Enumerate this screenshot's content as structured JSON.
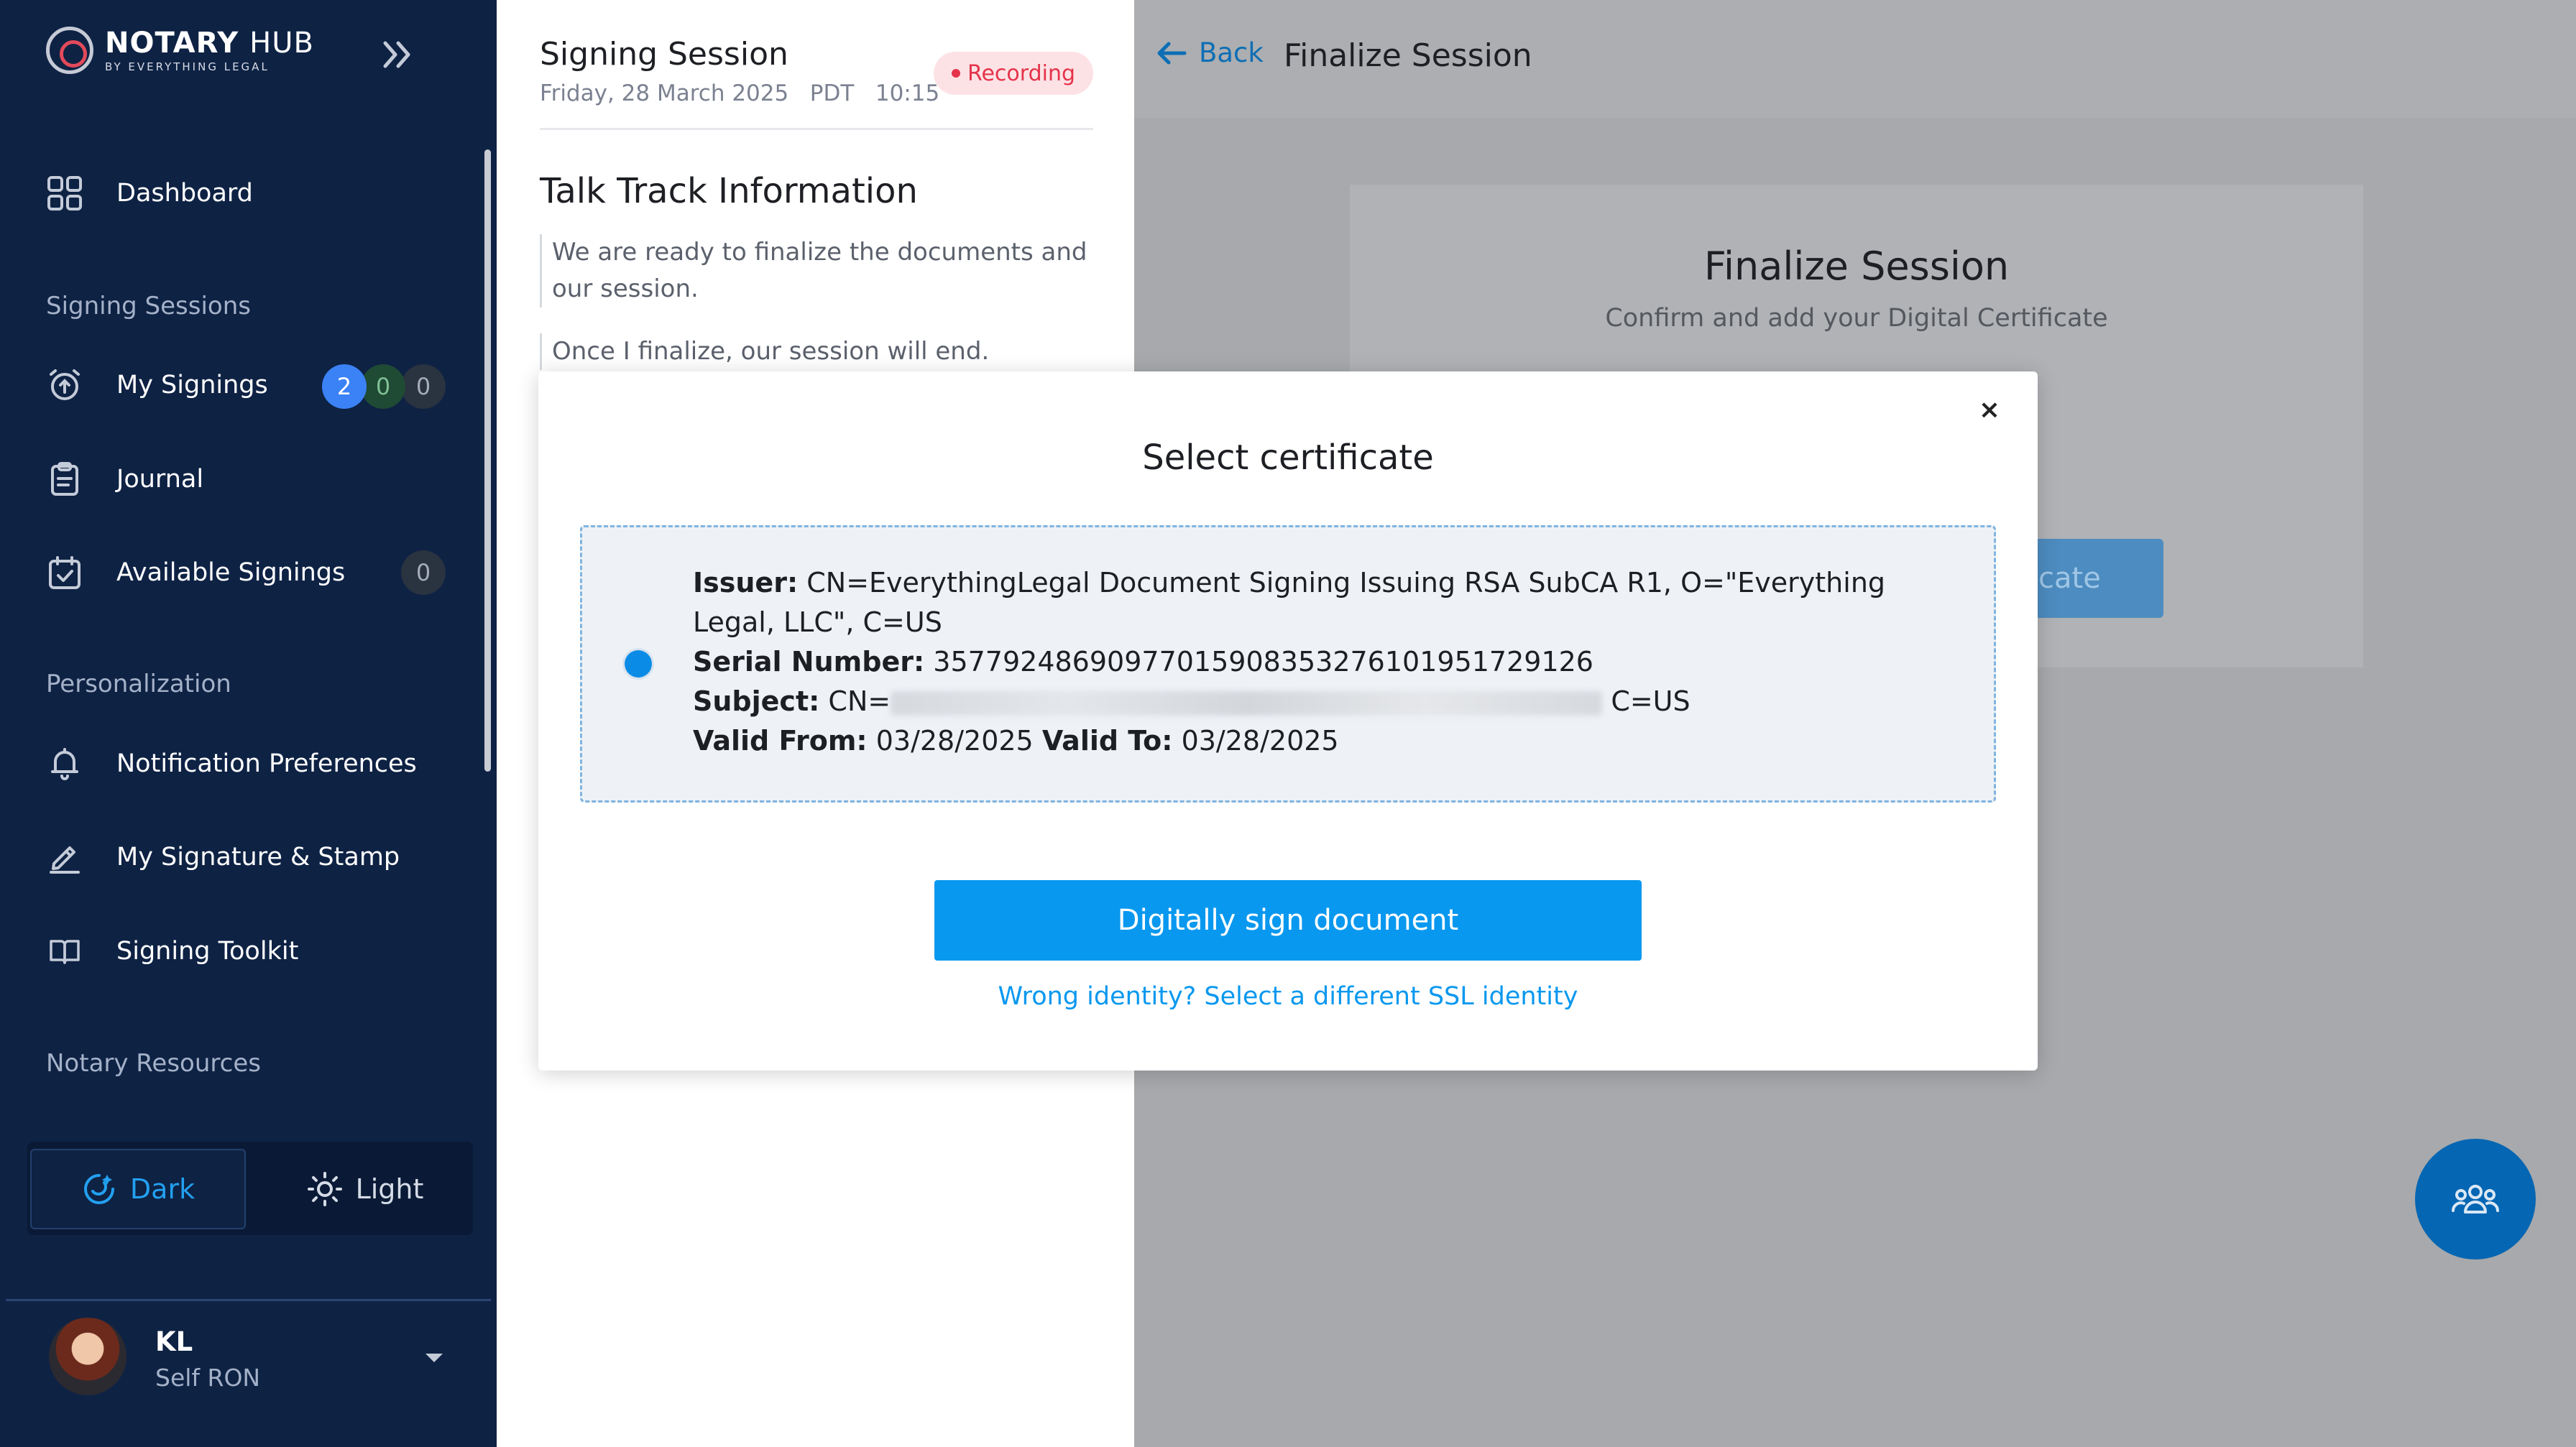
{
  "sidebar": {
    "brand": {
      "title_main": "NOTARY",
      "title_hub": "HUB",
      "subtitle": "BY EVERYTHING LEGAL"
    },
    "nav": {
      "dashboard": "Dashboard",
      "section_signing": "Signing Sessions",
      "my_signings": "My Signings",
      "my_signings_badges": [
        "2",
        "0",
        "0"
      ],
      "journal": "Journal",
      "available_signings": "Available Signings",
      "available_signings_badge": "0",
      "section_personalization": "Personalization",
      "notification_preferences": "Notification Preferences",
      "signature_stamp": "My Signature & Stamp",
      "signing_toolkit": "Signing Toolkit",
      "section_resources": "Notary Resources"
    },
    "theme": {
      "dark": "Dark",
      "light": "Light",
      "selected": "Dark"
    },
    "user": {
      "initials": "KL",
      "role": "Self RON"
    }
  },
  "session": {
    "title": "Signing Session",
    "date": "Friday, 28 March 2025",
    "timezone": "PDT",
    "time": "10:15",
    "status": "Recording",
    "talk_track_title": "Talk Track Information",
    "talk_track": [
      "We are ready to finalize the documents and our session.",
      "Once I finalize, our session will end."
    ]
  },
  "page": {
    "back": "Back",
    "title": "Finalize Session",
    "card_title": "Finalize Session",
    "card_subtitle": "Confirm and add your Digital Certificate",
    "card_button_partial": "cate"
  },
  "modal": {
    "title": "Select certificate",
    "close": "×",
    "certificate": {
      "issuer_label": "Issuer:",
      "issuer": "CN=EverythingLegal Document Signing Issuing RSA SubCA R1, O=\"Everything Legal, LLC\", C=US",
      "serial_label": "Serial Number:",
      "serial": "35779248690977015908353276101951729126",
      "subject_label": "Subject:",
      "subject_prefix": "CN=",
      "subject_suffix": "C=US",
      "valid_from_label": "Valid From:",
      "valid_from": "03/28/2025",
      "valid_to_label": "Valid To:",
      "valid_to": "03/28/2025",
      "selected": true
    },
    "sign_button": "Digitally sign document",
    "wrong_identity": "Wrong identity? Select a different SSL identity"
  },
  "colors": {
    "sidebar_bg": "#0e2244",
    "accent": "#0998ef",
    "recording": "#e4334a",
    "badge_blue": "#3b82f6",
    "badge_green": "#1f4a34"
  },
  "icons": [
    "collapse-sidebar-icon",
    "dashboard-grid-icon",
    "alarm-clock-icon",
    "clipboard-icon",
    "calendar-check-icon",
    "bell-icon",
    "pen-icon",
    "book-icon",
    "moon-icon",
    "sun-icon",
    "arrow-left-icon",
    "close-icon",
    "users-group-icon"
  ]
}
